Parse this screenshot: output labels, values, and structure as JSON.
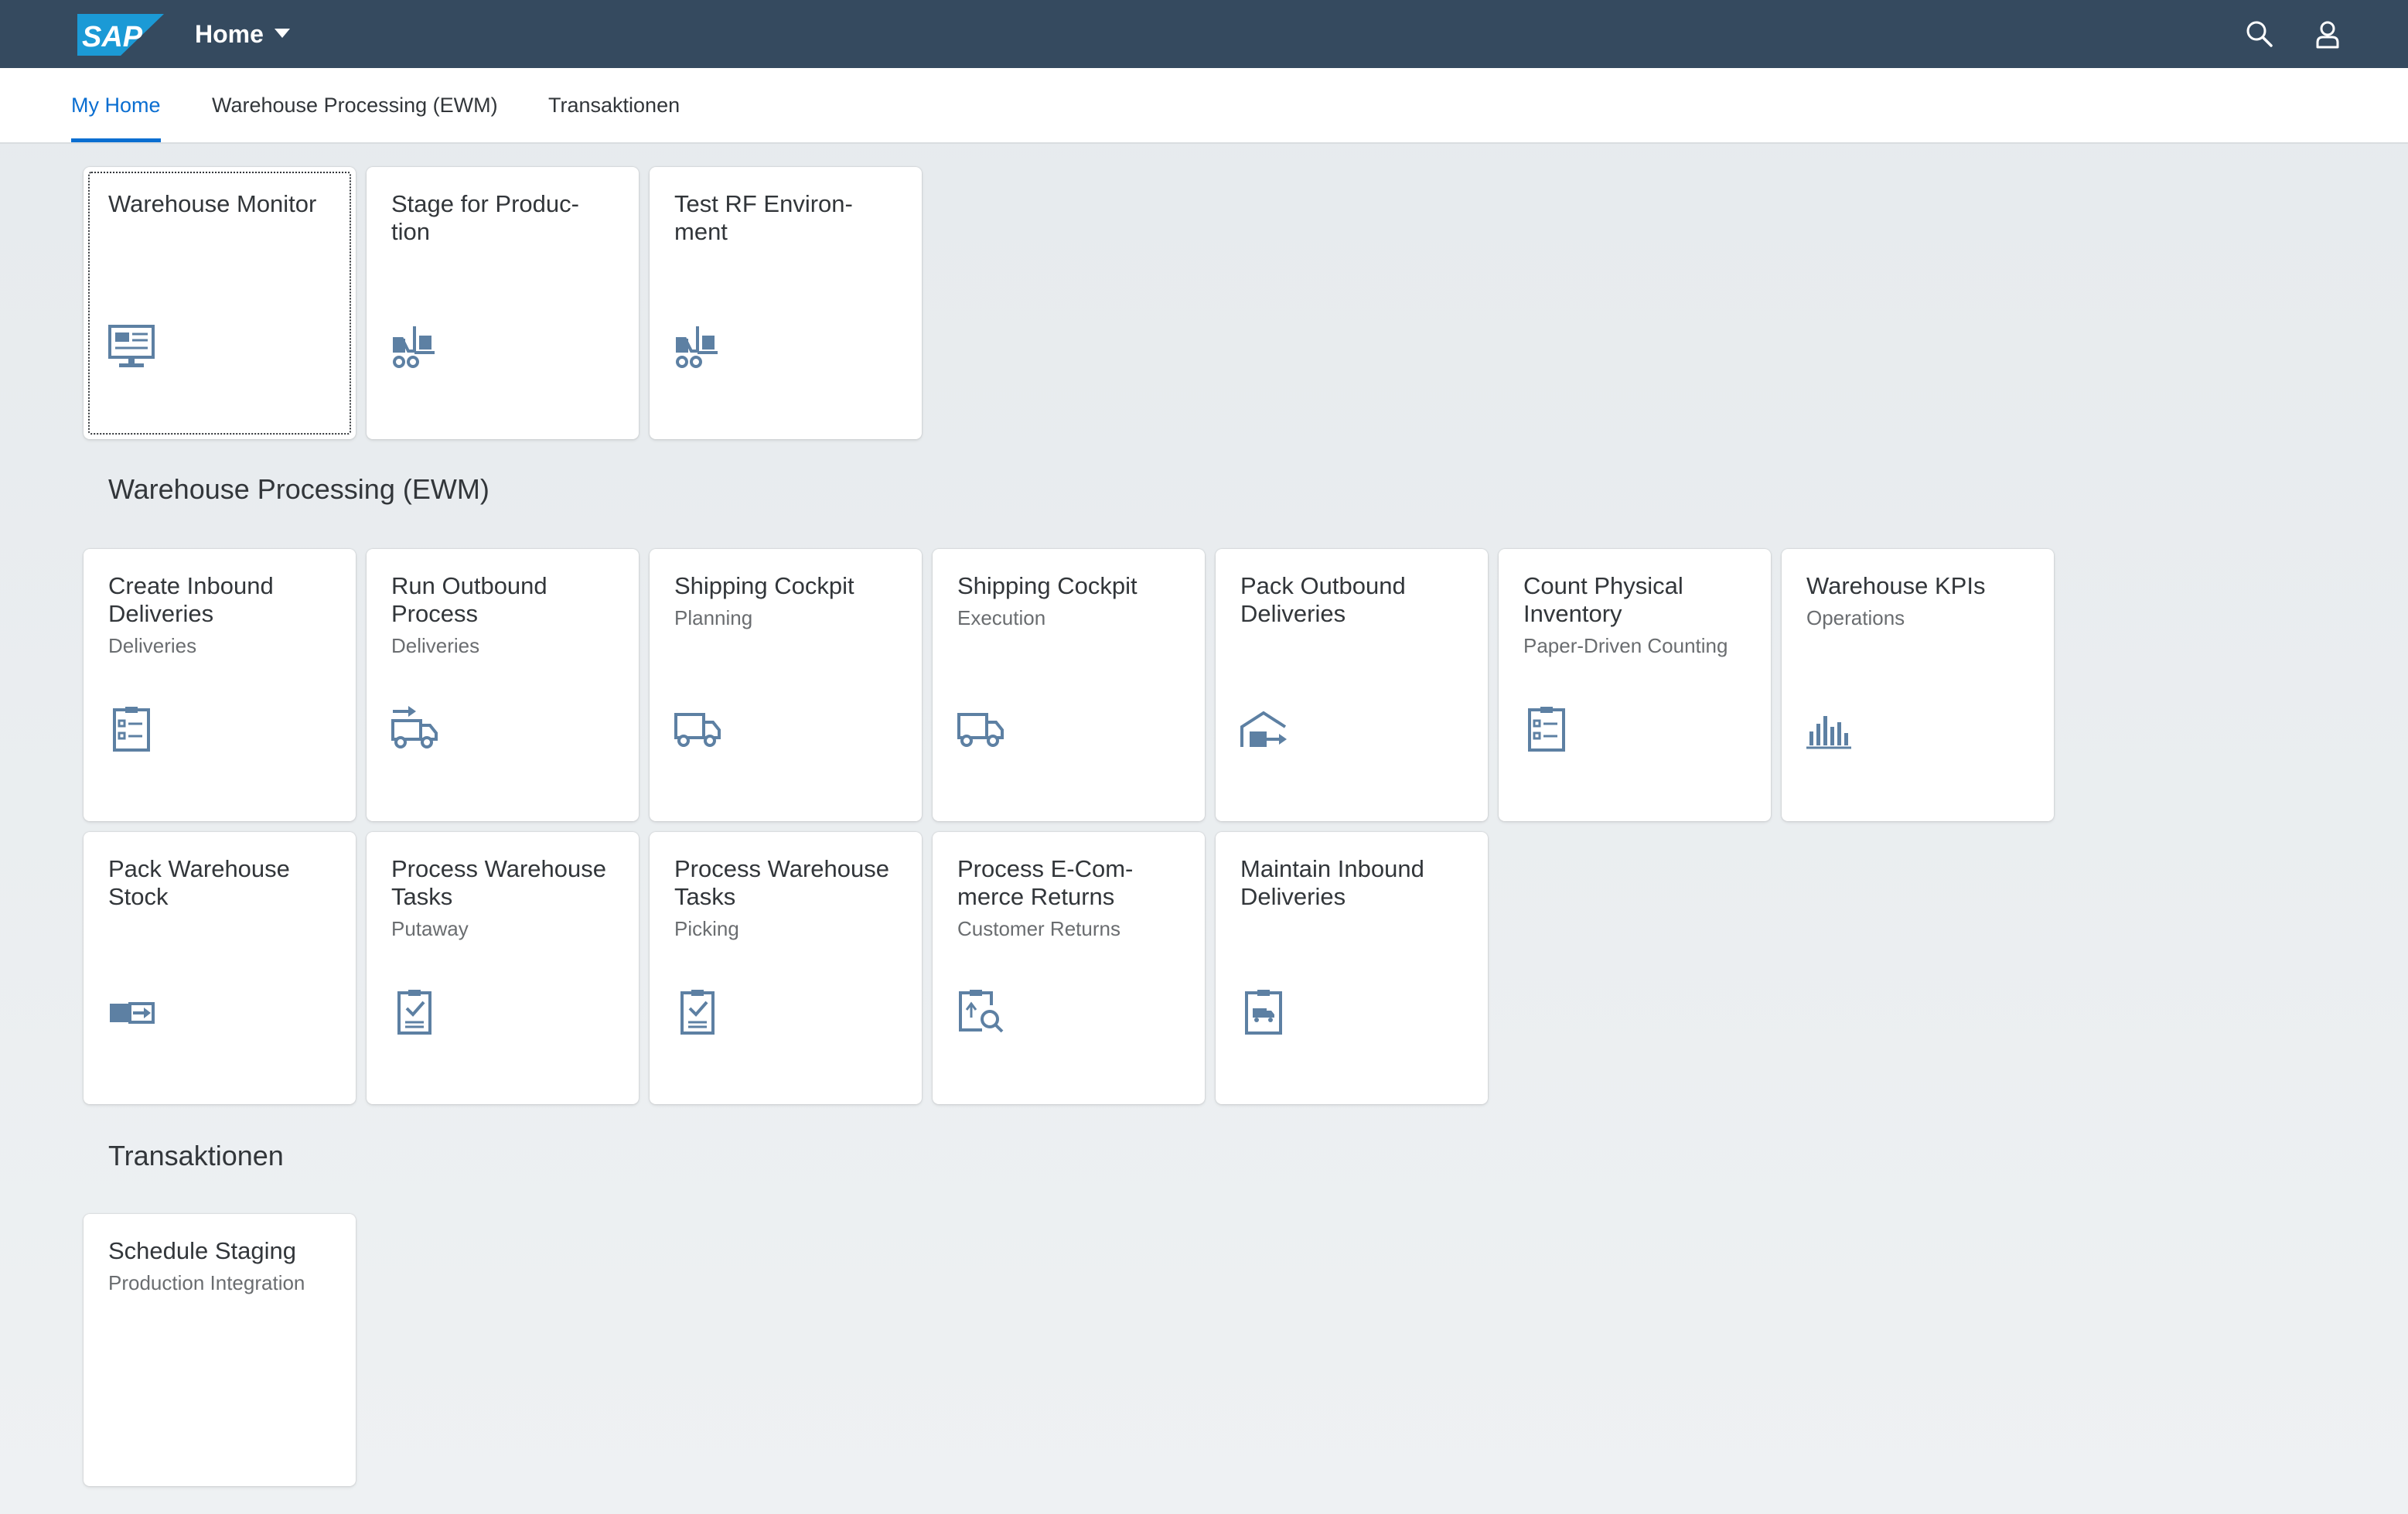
{
  "shell": {
    "logo": "SAP",
    "title": "Home",
    "search_icon": "search-icon",
    "user_icon": "user-icon",
    "colors": {
      "background": "#354a5f",
      "logo": "#1b9ad6"
    }
  },
  "anchor_bar": {
    "tabs": [
      {
        "label": "My Home",
        "active": true
      },
      {
        "label": "Warehouse Processing (EWM)",
        "active": false
      },
      {
        "label": "Transaktionen",
        "active": false
      }
    ]
  },
  "groups": [
    {
      "title": "",
      "tiles": [
        {
          "title": "Warehouse Monitor",
          "subtitle": "",
          "icon": "monitor-icon"
        },
        {
          "title": "Stage for Produc-tion",
          "subtitle": "",
          "icon": "forklift-icon"
        },
        {
          "title": "Test RF Environ-ment",
          "subtitle": "",
          "icon": "forklift-icon"
        }
      ]
    },
    {
      "title": "Warehouse Processing (EWM)",
      "tiles": [
        {
          "title": "Create Inbound Deliveries",
          "subtitle": "Deliveries",
          "icon": "checklist-icon"
        },
        {
          "title": "Run Outbound Process",
          "subtitle": "Deliveries",
          "icon": "truck-arrow-icon"
        },
        {
          "title": "Shipping Cockpit",
          "subtitle": "Planning",
          "icon": "truck-icon"
        },
        {
          "title": "Shipping Cockpit",
          "subtitle": "Execution",
          "icon": "truck-icon"
        },
        {
          "title": "Pack Outbound Deliveries",
          "subtitle": "",
          "icon": "warehouse-out-icon"
        },
        {
          "title": "Count Physical Inventory",
          "subtitle": "Paper-Driven Counting",
          "icon": "checklist-icon"
        },
        {
          "title": "Warehouse KPIs",
          "subtitle": "Operations",
          "icon": "bar-chart-icon"
        },
        {
          "title": "Pack Warehouse Stock",
          "subtitle": "",
          "icon": "stock-transfer-icon"
        },
        {
          "title": "Process Warehouse Tasks",
          "subtitle": "Putaway",
          "icon": "task-check-icon"
        },
        {
          "title": "Process Warehouse Tasks",
          "subtitle": "Picking",
          "icon": "task-check-icon"
        },
        {
          "title": "Process E-Com-merce Returns",
          "subtitle": "Customer Returns",
          "icon": "returns-search-icon"
        },
        {
          "title": "Maintain Inbound Deliveries",
          "subtitle": "",
          "icon": "clipboard-truck-icon"
        }
      ]
    },
    {
      "title": "Transaktionen",
      "tiles": [
        {
          "title": "Schedule Staging",
          "subtitle": "Production Integration",
          "icon": ""
        }
      ]
    }
  ]
}
